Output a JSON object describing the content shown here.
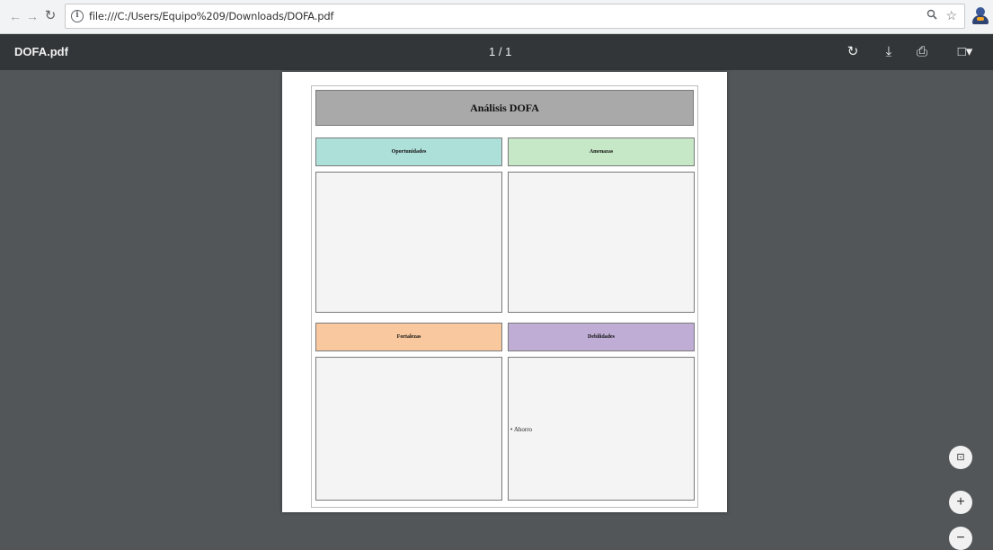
{
  "browser": {
    "back_icon": "←",
    "forward_icon": "→",
    "reload_icon": "↻",
    "info_icon": "i",
    "url": "file:///C:/Users/Equipo%209/Downloads/DOFA.pdf",
    "zoom_icon": "🔍",
    "star_icon": "☆"
  },
  "pdf_toolbar": {
    "title": "DOFA.pdf",
    "page_indicator": "1 / 1",
    "rotate_icon": "↻",
    "download_icon": "⤓",
    "print_icon": "⎙",
    "bookmark_icon": "□▾"
  },
  "document": {
    "title": "Análisis DOFA",
    "quadrants": {
      "opportunities": {
        "label": "Oportunidades",
        "color": "#aee0da"
      },
      "threats": {
        "label": "Amenazas",
        "color": "#c6e8c6"
      },
      "strengths": {
        "label": "Fortalezas",
        "color": "#f9c89e"
      },
      "weaknesses": {
        "label": "Debilidades",
        "color": "#bfadd6",
        "items": [
          "• Ahorro"
        ]
      }
    }
  },
  "zoom_controls": {
    "fit_icon": "⊡",
    "zoom_in_icon": "+",
    "zoom_out_icon": "−"
  },
  "colors": {
    "toolbar_bg": "#323639",
    "viewer_bg": "#525659",
    "title_bar_bg": "#a9a9a9"
  }
}
